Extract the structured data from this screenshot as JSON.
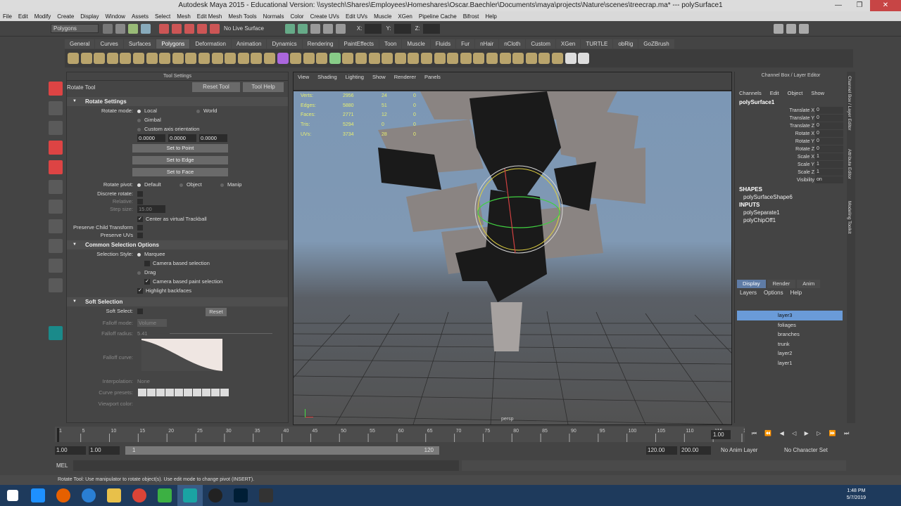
{
  "window": {
    "title": "Autodesk Maya 2015 - Educational Version: \\\\systech\\Shares\\Employees\\Homeshares\\Oscar.Baechler\\Documents\\maya\\projects\\Nature\\scenes\\treecrap.ma*  ---  polySurface1",
    "min_label": "—",
    "max_label": "❐",
    "close_label": "✕"
  },
  "menubar": [
    "File",
    "Edit",
    "Modify",
    "Create",
    "Display",
    "Window",
    "Assets",
    "Select",
    "Mesh",
    "Edit Mesh",
    "Mesh Tools",
    "Normals",
    "Color",
    "Create UVs",
    "Edit UVs",
    "Muscle",
    "XGen",
    "Pipeline Cache",
    "Bifrost",
    "Help"
  ],
  "statusline": {
    "mode": "Polygons",
    "live": "No Live Surface",
    "x_label": "X:",
    "y_label": "Y:",
    "z_label": "Z:"
  },
  "shelf_tabs": [
    "General",
    "Curves",
    "Surfaces",
    "Polygons",
    "Deformation",
    "Animation",
    "Dynamics",
    "Rendering",
    "PaintEffects",
    "Toon",
    "Muscle",
    "Fluids",
    "Fur",
    "nHair",
    "nCloth",
    "Custom",
    "XGen",
    "TURTLE",
    "obRig",
    "GoZBrush"
  ],
  "shelf_active": "Polygons",
  "tool_settings": {
    "header": "Tool Settings",
    "tool_name": "Rotate Tool",
    "reset_tool": "Reset Tool",
    "tool_help": "Tool Help",
    "rotate_settings": "Rotate Settings",
    "rotate_mode_label": "Rotate mode:",
    "local": "Local",
    "world": "World",
    "gimbal": "Gimbal",
    "custom_axis": "Custom axis orientation",
    "v1": "0.0000",
    "v2": "0.0000",
    "v3": "0.0000",
    "set_point": "Set to Point",
    "set_edge": "Set to Edge",
    "set_face": "Set to Face",
    "rotate_pivot_label": "Rotate pivot:",
    "pivot_default": "Default",
    "pivot_object": "Object",
    "pivot_manip": "Manip",
    "discrete_rotate": "Discrete rotate:",
    "relative": "Relative:",
    "step_size": "Step size:",
    "step_value": "15.00",
    "center_trackball": "Center as virtual Trackball",
    "preserve_child": "Preserve Child Transform",
    "preserve_uvs": "Preserve UVs",
    "common_selection": "Common Selection Options",
    "selection_style": "Selection Style:",
    "marquee": "Marquee",
    "camera_based": "Camera based selection",
    "drag": "Drag",
    "camera_paint": "Camera based paint selection",
    "highlight_backfaces": "Highlight backfaces",
    "soft_selection": "Soft Selection",
    "soft_select": "Soft Select:",
    "reset": "Reset",
    "falloff_mode": "Falloff mode:",
    "falloff_mode_value": "Volume",
    "falloff_radius": "Falloff radius:",
    "falloff_radius_value": "5.41",
    "falloff_curve": "Falloff curve:",
    "interpolation": "Interpolation:",
    "interpolation_value": "None",
    "curve_presets": "Curve presets:",
    "viewport_color": "Viewport color:"
  },
  "viewport": {
    "menu": [
      "View",
      "Shading",
      "Lighting",
      "Show",
      "Renderer",
      "Panels"
    ],
    "hud_labels": [
      "Verts:",
      "Edges:",
      "Faces:",
      "Tris:",
      "UVs:"
    ],
    "hud_values": [
      "2956",
      "5880",
      "2771",
      "5294",
      "3734"
    ],
    "hud_sel": [
      "24",
      "51",
      "12",
      "0",
      "28"
    ],
    "hud_comp": [
      "0",
      "0",
      "0",
      "0",
      "0"
    ],
    "camera": "persp"
  },
  "channel_box": {
    "header": "Channel Box / Layer Editor",
    "menu": [
      "Channels",
      "Edit",
      "Object",
      "Show"
    ],
    "object": "polySurface1",
    "attrs": [
      {
        "name": "Translate X",
        "value": "0"
      },
      {
        "name": "Translate Y",
        "value": "0"
      },
      {
        "name": "Translate Z",
        "value": "0"
      },
      {
        "name": "Rotate X",
        "value": "0"
      },
      {
        "name": "Rotate Y",
        "value": "0"
      },
      {
        "name": "Rotate Z",
        "value": "0"
      },
      {
        "name": "Scale X",
        "value": "1"
      },
      {
        "name": "Scale Y",
        "value": "1"
      },
      {
        "name": "Scale Z",
        "value": "1"
      },
      {
        "name": "Visibility",
        "value": "on"
      }
    ],
    "shapes_label": "SHAPES",
    "shape": "polySurfaceShape6",
    "inputs_label": "INPUTS",
    "inputs": [
      "polySeparate1",
      "polyChipOff1"
    ]
  },
  "layer_editor": {
    "tabs": [
      "Display",
      "Render",
      "Anim"
    ],
    "menu": [
      "Layers",
      "Options",
      "Help"
    ],
    "layers": [
      "layer3",
      "foliages",
      "branches",
      "trunk",
      "layer2",
      "layer1"
    ]
  },
  "sidebar_tabs": [
    "Channel Box / Layer Editor",
    "Attribute Editor",
    "Modeling Toolkit"
  ],
  "timeline": {
    "ticks": [
      "1",
      "5",
      "10",
      "15",
      "20",
      "25",
      "30",
      "35",
      "40",
      "45",
      "50",
      "55",
      "60",
      "65",
      "70",
      "75",
      "80",
      "85",
      "90",
      "95",
      "100",
      "105",
      "110",
      "115",
      "120"
    ],
    "current": "1.00"
  },
  "range": {
    "start": "1.00",
    "start2": "1.00",
    "slider_start": "1",
    "slider_end": "120",
    "end": "120.00",
    "end2": "200.00",
    "anim_layer": "No Anim Layer",
    "char_set": "No Character Set"
  },
  "cmdline": {
    "label": "MEL"
  },
  "helpline": "Rotate Tool: Use manipulator to rotate object(s). Use edit mode to change pivot (INSERT).",
  "clock": {
    "time": "1:48 PM",
    "date": "5/7/2019"
  },
  "colors": {
    "selected_layer": "#6a9bd8",
    "hud": "#e8f070",
    "close": "#c74545"
  }
}
